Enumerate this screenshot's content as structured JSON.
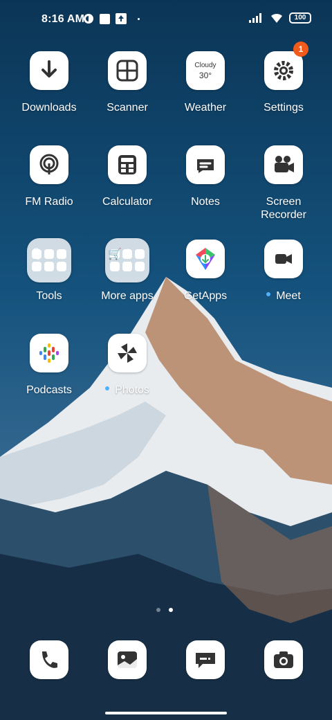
{
  "status": {
    "time": "8:16 AM",
    "battery": "100"
  },
  "apps": [
    {
      "name": "Downloads"
    },
    {
      "name": "Scanner"
    },
    {
      "name": "Weather",
      "widget_text": "Cloudy",
      "widget_temp": "30°"
    },
    {
      "name": "Settings",
      "badge": "1"
    },
    {
      "name": "FM Radio"
    },
    {
      "name": "Calculator"
    },
    {
      "name": "Notes"
    },
    {
      "name": "Screen\nRecorder"
    },
    {
      "name": "Tools"
    },
    {
      "name": "More apps"
    },
    {
      "name": "GetApps"
    },
    {
      "name": "Meet"
    },
    {
      "name": "Podcasts"
    },
    {
      "name": "Photos"
    }
  ],
  "dock": [
    {
      "name": "Phone"
    },
    {
      "name": "Gallery"
    },
    {
      "name": "Messages"
    },
    {
      "name": "Camera"
    }
  ]
}
